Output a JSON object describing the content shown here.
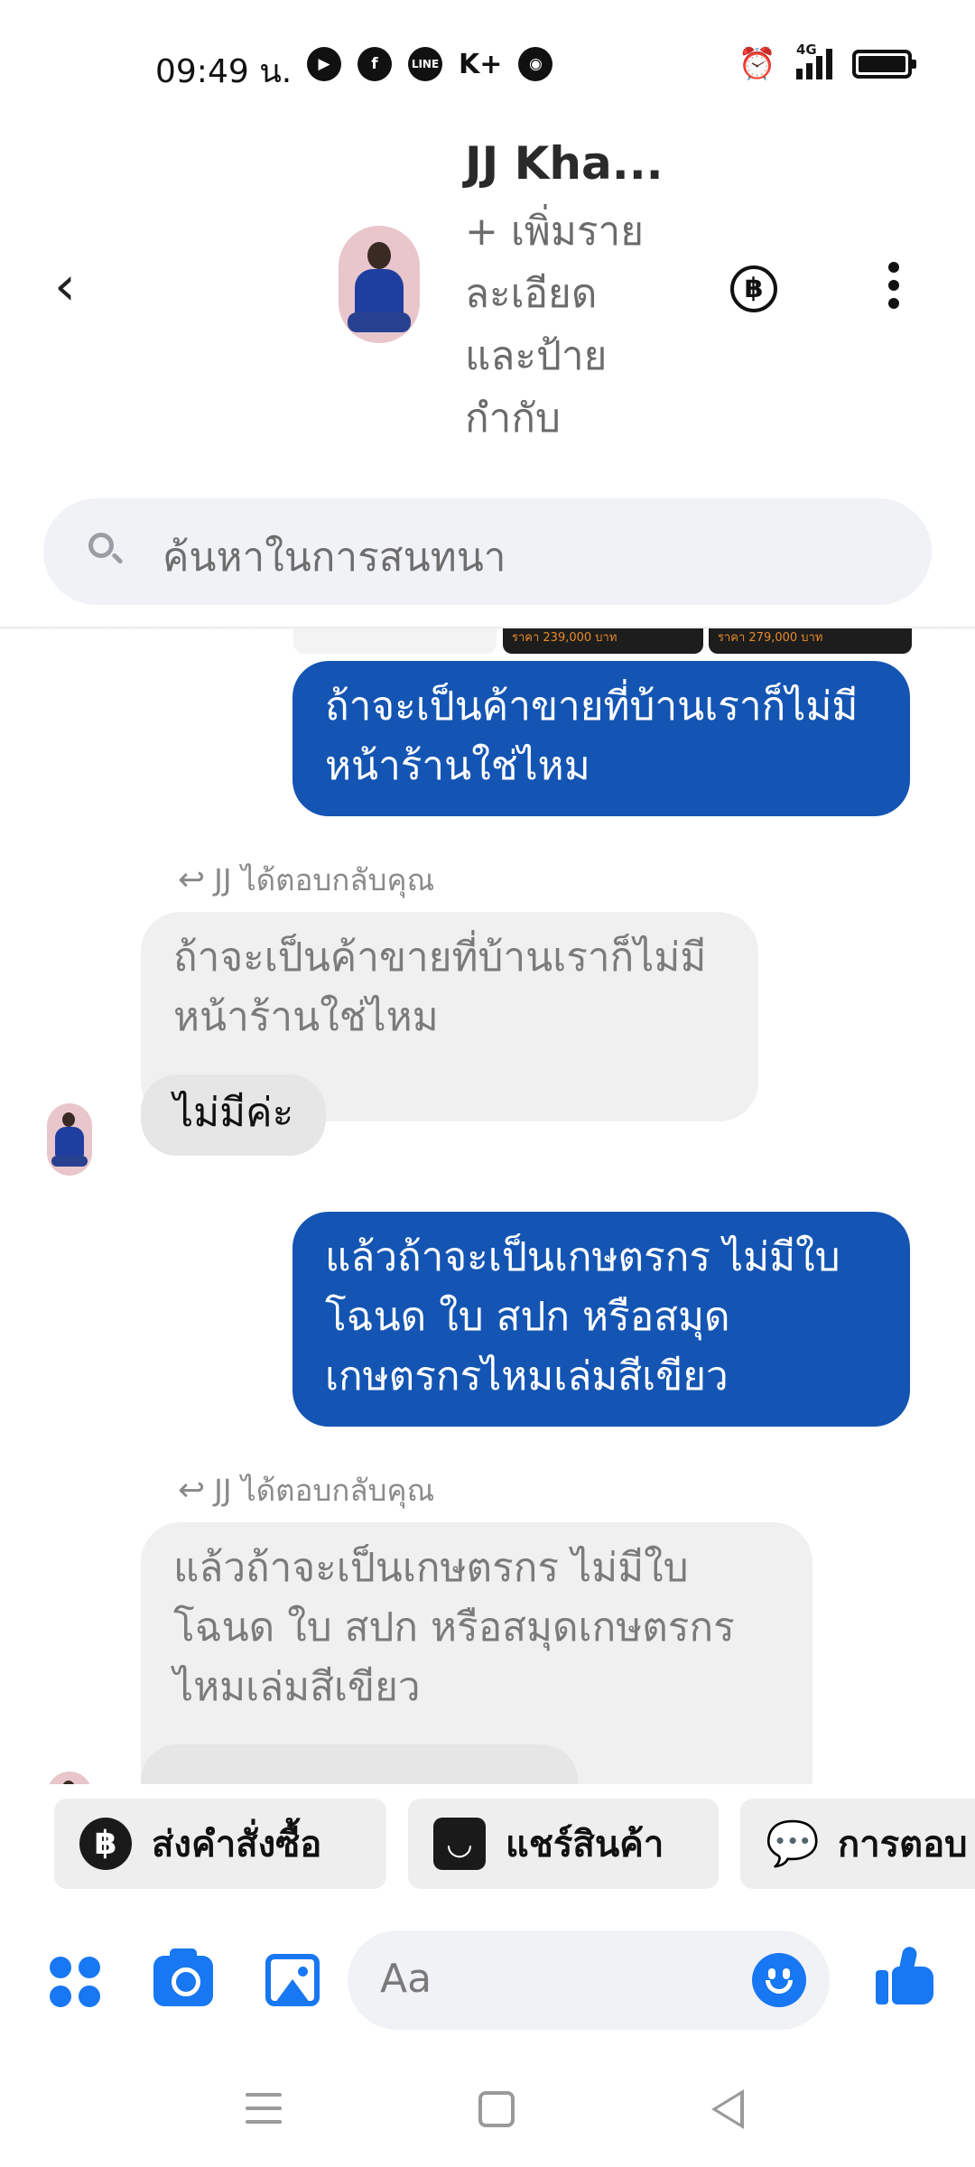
{
  "status_bar": {
    "time": "09:49 น.",
    "left_icons": [
      "screen-record-icon",
      "facebook-icon",
      "line-icon",
      "kplus-icon",
      "chrome-icon"
    ],
    "kplus_label": "K+",
    "network_label": "4G",
    "right_icons": [
      "alarm-icon",
      "signal-icon",
      "battery-icon"
    ]
  },
  "header": {
    "contact_name": "JJ Kha...",
    "subtitle_lines": [
      "+ เพิ่มราย",
      "ละเอียด",
      "และป้าย",
      "กำกับ"
    ],
    "payment_icon": "฿",
    "accent": "#1877f2"
  },
  "search": {
    "placeholder": "ค้นหาในการสนทนา"
  },
  "preview_attachment": {
    "price_1": "ราคา 239,000 บาท",
    "price_2": "ราคา 279,000 บาท"
  },
  "messages": [
    {
      "type": "outgoing",
      "lines": [
        "ถ้าจะเป็นค้าขายที่บ้านเราก็ไม่มี",
        "หน้าร้านใช่ไหม"
      ]
    },
    {
      "type": "reply",
      "reply_label": "JJ ได้ตอบกลับคุณ",
      "quoted_lines": [
        "ถ้าจะเป็นค้าขายที่บ้านเราก็ไม่มี",
        "หน้าร้านใช่ไหม"
      ],
      "text": "ไม่มีค่ะ"
    },
    {
      "type": "outgoing",
      "lines": [
        "แล้วถ้าจะเป็นเกษตรกร ไม่มีใบ",
        "โฉนด ใบ สปก หรือสมุด",
        "เกษตรกรไหมเล่มสีเขียว"
      ]
    },
    {
      "type": "reply",
      "reply_label": "JJ ได้ตอบกลับคุณ",
      "quoted_lines": [
        "แล้วถ้าจะเป็นเกษตรกร ไม่มีใบ",
        "โฉนด ใบ สปก หรือสมุดเกษตรกร",
        "ไหมเล่มสีเขียว"
      ]
    }
  ],
  "bubble_colors": {
    "outgoing": "#1455b3",
    "incoming": "#e6e6e6",
    "quoted": "#f0f0f0"
  },
  "quick_actions": [
    {
      "label": "ส่งคำสั่งซื้อ",
      "icon": "baht-icon",
      "glyph": "฿"
    },
    {
      "label": "แชร์สินค้า",
      "icon": "shopping-bag-icon",
      "glyph": "◡"
    },
    {
      "label": "การตอบ",
      "icon": "chat-bubbles-icon",
      "glyph": "💬"
    }
  ],
  "composer": {
    "placeholder": "Aa"
  }
}
